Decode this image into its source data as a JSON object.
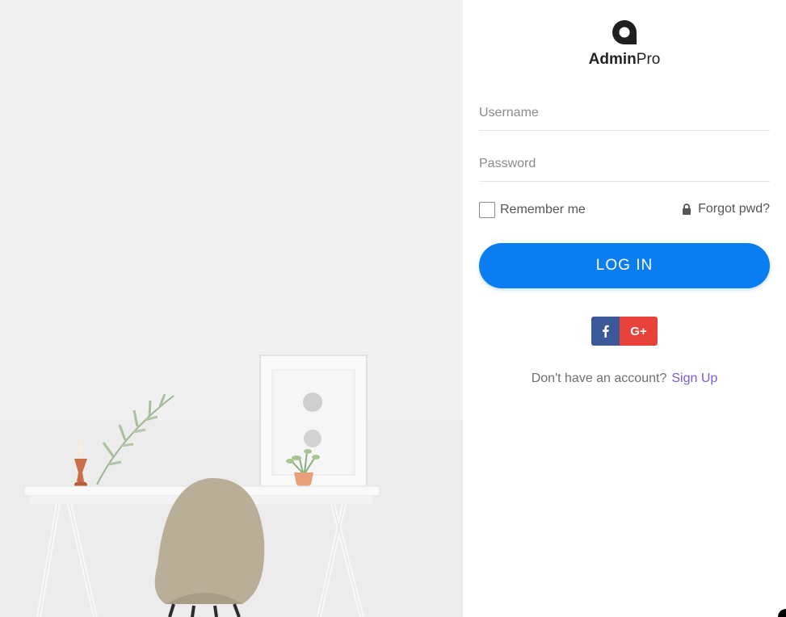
{
  "brand": {
    "name_bold": "Admin",
    "name_light": "Pro"
  },
  "form": {
    "username_placeholder": "Username",
    "username_value": "",
    "password_placeholder": "Password",
    "password_value": "",
    "remember_label": "Remember me",
    "remember_checked": false,
    "forgot_label": "Forgot pwd?",
    "login_label": "LOG IN"
  },
  "social": {
    "facebook_label": "f",
    "google_label": "G+"
  },
  "signup": {
    "prompt": "Don't have an account?",
    "link_label": "Sign Up"
  },
  "colors": {
    "primary": "#0a7ef1",
    "facebook": "#3b5998",
    "google": "#e8433b",
    "link": "#7b5cd6"
  },
  "icons": {
    "logo": "brand-logo-icon",
    "lock": "lock-icon",
    "facebook": "facebook-icon",
    "google": "google-plus-icon"
  }
}
